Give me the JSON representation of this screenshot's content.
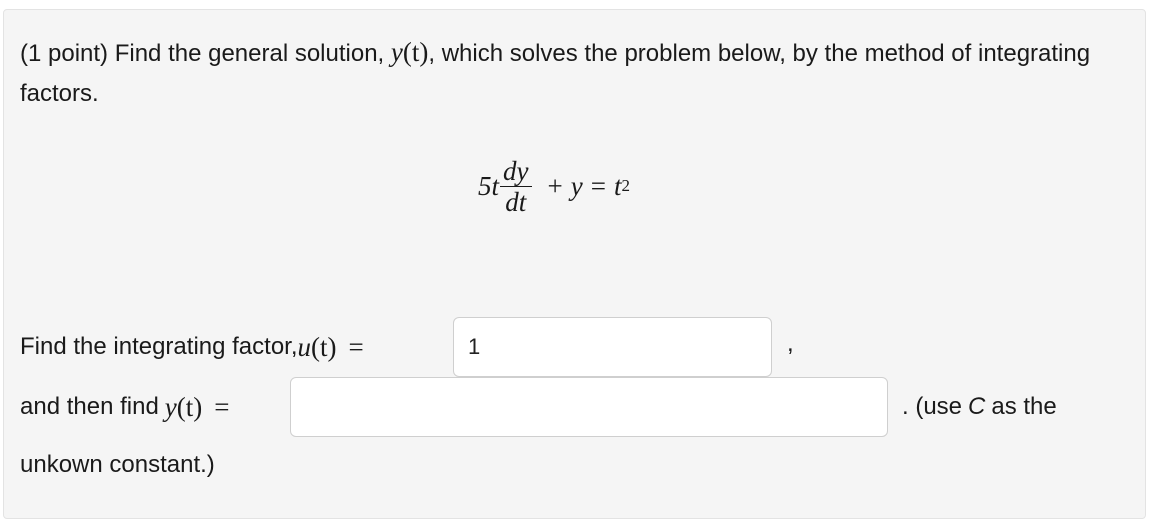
{
  "problem": {
    "prefix": "(1 point) Find the general solution, ",
    "y_func_var": "y",
    "y_func_arg": "(t)",
    "suffix": ", which solves the problem below, by the method of integrating factors."
  },
  "equation": {
    "coefficient": "5t",
    "numerator": "dy",
    "denominator": "dt",
    "plus": "+",
    "y": "y",
    "equals": "=",
    "rhs_base": "t",
    "rhs_exp": "2"
  },
  "step1": {
    "label": "Find the integrating factor, ",
    "func_var": "u",
    "func_arg": "(t)",
    "equals": "=",
    "input_value": "1",
    "trailing": ","
  },
  "step2": {
    "label": "and then find ",
    "func_var": "y",
    "func_arg": "(t)",
    "equals": "=",
    "input_value": "",
    "note_pre": ". (use",
    "note_var": "C",
    "note_post": "as the"
  },
  "step3": {
    "text": "unkown constant.)"
  }
}
